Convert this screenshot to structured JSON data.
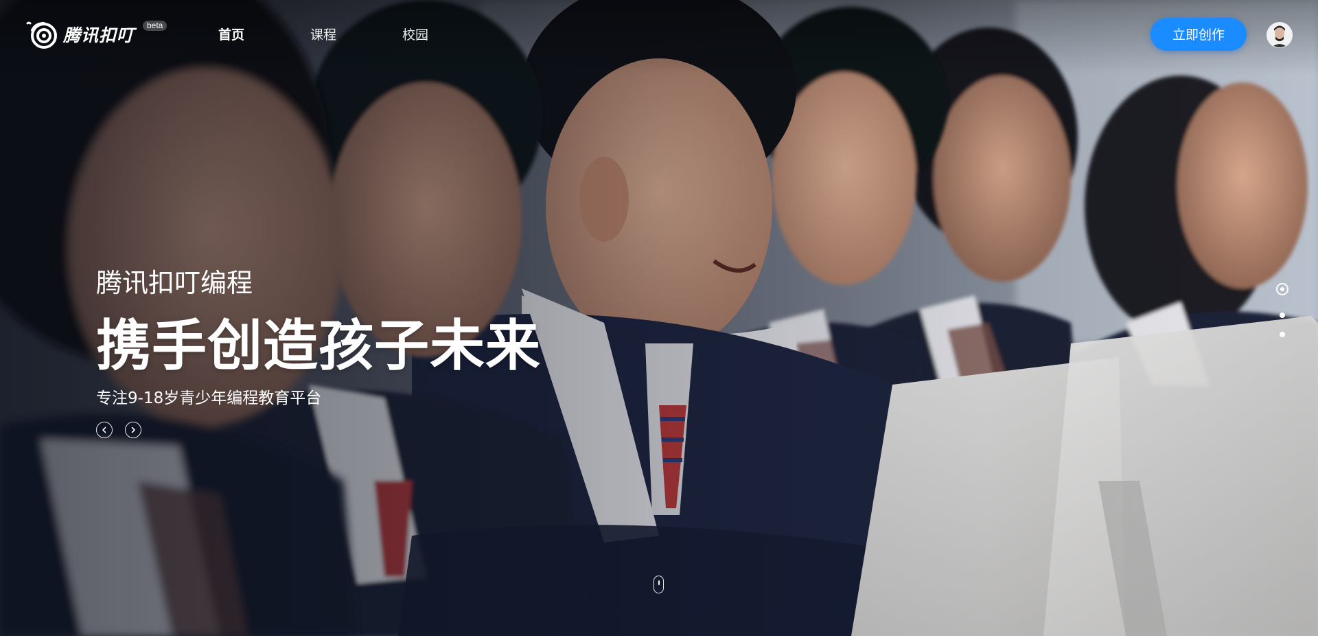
{
  "header": {
    "logo_text": "腾讯扣叮",
    "beta_label": "beta",
    "nav": [
      {
        "label": "首页",
        "active": true
      },
      {
        "label": "课程",
        "active": false
      },
      {
        "label": "校园",
        "active": false
      }
    ],
    "create_button_label": "立即创作",
    "accent_color": "#1a8cff"
  },
  "hero": {
    "subtitle": "腾讯扣叮编程",
    "title": "携手创造孩子未来",
    "tagline": "专注9-18岁青少年编程教育平台",
    "prev_icon": "chevron-left-circle-icon",
    "next_icon": "chevron-right-circle-icon"
  },
  "carousel": {
    "slide_count": 3,
    "active_slide": 1
  },
  "scroll_indicator_icon": "mouse-scroll-icon"
}
